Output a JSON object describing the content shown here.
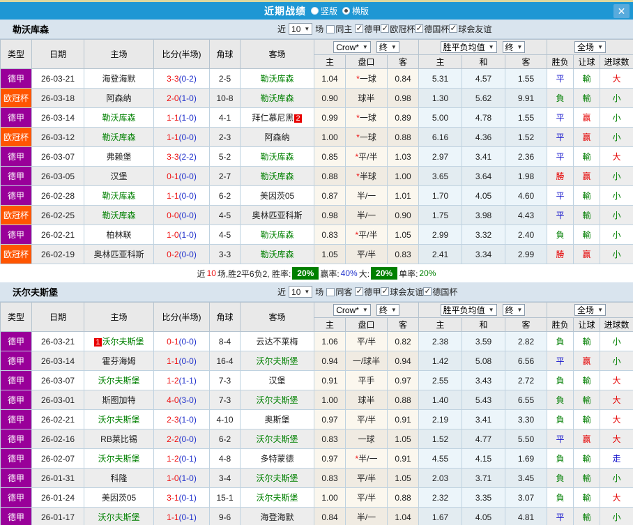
{
  "titlebar": {
    "title": "近期战绩",
    "radio_options": [
      {
        "label": "竖版",
        "selected": false
      },
      {
        "label": "横版",
        "selected": true
      }
    ],
    "close_label": "✕"
  },
  "labels": {
    "near": "近",
    "games": "场"
  },
  "table_header": {
    "cols": [
      "类型",
      "日期",
      "主场",
      "比分(半场)",
      "角球",
      "客场"
    ],
    "odds_source_dd": "Crow*",
    "odds_final_dd": "终",
    "avg_dd": "胜平负均值",
    "avg_final_dd": "终",
    "scope_dd": "全场",
    "sub": [
      "主",
      "盘口",
      "客",
      "主",
      "和",
      "客",
      "胜负",
      "让球",
      "进球数"
    ]
  },
  "league_colors": {
    "德甲": "#990099",
    "欧冠杯": "#ff5500"
  },
  "result_colors": {
    "勝": "res-red",
    "赢": "res-red",
    "大": "res-red",
    "負": "res-green",
    "輸": "res-green",
    "小": "res-green",
    "平": "res-blue",
    "走": "res-blue"
  },
  "sections": [
    {
      "team": "勒沃库森",
      "controls": {
        "count": "10",
        "same_label": "同主",
        "same_checked": false,
        "leagues": [
          {
            "label": "德甲",
            "checked": true
          },
          {
            "label": "欧冠杯",
            "checked": true
          },
          {
            "label": "德国杯",
            "checked": true
          },
          {
            "label": "球会友谊",
            "checked": true
          }
        ]
      },
      "rows": [
        {
          "league": "德甲",
          "date": "26-03-21",
          "home": "海登海默",
          "home_focus": false,
          "score": "3-3",
          "half": "(0-2)",
          "corner": "2-5",
          "away": "勒沃库森",
          "away_focus": true,
          "handicap": [
            "1.04",
            "*一球",
            "0.84"
          ],
          "avg": [
            "5.31",
            "4.57",
            "1.55"
          ],
          "results": [
            "平",
            "輸",
            "大"
          ]
        },
        {
          "league": "欧冠杯",
          "date": "26-03-18",
          "home": "阿森纳",
          "home_focus": false,
          "score": "2-0",
          "half": "(1-0)",
          "corner": "10-8",
          "away": "勒沃库森",
          "away_focus": true,
          "handicap": [
            "0.90",
            "球半",
            "0.98"
          ],
          "avg": [
            "1.30",
            "5.62",
            "9.91"
          ],
          "results": [
            "負",
            "輸",
            "小"
          ]
        },
        {
          "league": "德甲",
          "date": "26-03-14",
          "home": "勒沃库森",
          "home_focus": true,
          "score": "1-1",
          "half": "(1-0)",
          "corner": "4-1",
          "away": "拜仁慕尼黑",
          "away_focus": false,
          "away_badge": {
            "text": "2",
            "pos": "after"
          },
          "handicap": [
            "0.99",
            "*一球",
            "0.89"
          ],
          "avg": [
            "5.00",
            "4.78",
            "1.55"
          ],
          "results": [
            "平",
            "赢",
            "小"
          ]
        },
        {
          "league": "欧冠杯",
          "date": "26-03-12",
          "home": "勒沃库森",
          "home_focus": true,
          "score": "1-1",
          "half": "(0-0)",
          "corner": "2-3",
          "away": "阿森纳",
          "away_focus": false,
          "handicap": [
            "1.00",
            "*一球",
            "0.88"
          ],
          "avg": [
            "6.16",
            "4.36",
            "1.52"
          ],
          "results": [
            "平",
            "赢",
            "小"
          ]
        },
        {
          "league": "德甲",
          "date": "26-03-07",
          "home": "弗赖堡",
          "home_focus": false,
          "score": "3-3",
          "half": "(2-2)",
          "corner": "5-2",
          "away": "勒沃库森",
          "away_focus": true,
          "handicap": [
            "0.85",
            "*平/半",
            "1.03"
          ],
          "avg": [
            "2.97",
            "3.41",
            "2.36"
          ],
          "results": [
            "平",
            "輸",
            "大"
          ]
        },
        {
          "league": "德甲",
          "date": "26-03-05",
          "home": "汉堡",
          "home_focus": false,
          "score": "0-1",
          "half": "(0-0)",
          "corner": "2-7",
          "away": "勒沃库森",
          "away_focus": true,
          "handicap": [
            "0.88",
            "*半球",
            "1.00"
          ],
          "avg": [
            "3.65",
            "3.64",
            "1.98"
          ],
          "results": [
            "勝",
            "赢",
            "小"
          ]
        },
        {
          "league": "德甲",
          "date": "26-02-28",
          "home": "勒沃库森",
          "home_focus": true,
          "score": "1-1",
          "half": "(0-0)",
          "corner": "6-2",
          "away": "美因茨05",
          "away_focus": false,
          "handicap": [
            "0.87",
            "半/一",
            "1.01"
          ],
          "avg": [
            "1.70",
            "4.05",
            "4.60"
          ],
          "results": [
            "平",
            "輸",
            "小"
          ]
        },
        {
          "league": "欧冠杯",
          "date": "26-02-25",
          "home": "勒沃库森",
          "home_focus": true,
          "score": "0-0",
          "half": "(0-0)",
          "corner": "4-5",
          "away": "奥林匹亚科斯",
          "away_focus": false,
          "handicap": [
            "0.98",
            "半/一",
            "0.90"
          ],
          "avg": [
            "1.75",
            "3.98",
            "4.43"
          ],
          "results": [
            "平",
            "輸",
            "小"
          ]
        },
        {
          "league": "德甲",
          "date": "26-02-21",
          "home": "柏林联",
          "home_focus": false,
          "score": "1-0",
          "half": "(1-0)",
          "corner": "4-5",
          "away": "勒沃库森",
          "away_focus": true,
          "handicap": [
            "0.83",
            "*平/半",
            "1.05"
          ],
          "avg": [
            "2.99",
            "3.32",
            "2.40"
          ],
          "results": [
            "負",
            "輸",
            "小"
          ]
        },
        {
          "league": "欧冠杯",
          "date": "26-02-19",
          "home": "奥林匹亚科斯",
          "home_focus": false,
          "score": "0-2",
          "half": "(0-0)",
          "corner": "3-3",
          "away": "勒沃库森",
          "away_focus": true,
          "handicap": [
            "1.05",
            "平/半",
            "0.83"
          ],
          "avg": [
            "2.41",
            "3.34",
            "2.99"
          ],
          "results": [
            "勝",
            "赢",
            "小"
          ]
        }
      ],
      "summary": [
        {
          "t": "近",
          "s": "k"
        },
        {
          "t": "10",
          "s": "r"
        },
        {
          "t": "场,胜2平6负2, 胜率:",
          "s": "k"
        },
        {
          "t": "20%",
          "s": "badge"
        },
        {
          "t": "赢率:",
          "s": "k"
        },
        {
          "t": "40%",
          "s": "b"
        },
        {
          "t": "大:",
          "s": "k"
        },
        {
          "t": "20%",
          "s": "badge"
        },
        {
          "t": "单率:",
          "s": "k"
        },
        {
          "t": "20%",
          "s": "g"
        }
      ]
    },
    {
      "team": "沃尔夫斯堡",
      "controls": {
        "count": "10",
        "same_label": "同客",
        "same_checked": false,
        "leagues": [
          {
            "label": "德甲",
            "checked": true
          },
          {
            "label": "球会友谊",
            "checked": true
          },
          {
            "label": "德国杯",
            "checked": true
          }
        ]
      },
      "rows": [
        {
          "league": "德甲",
          "date": "26-03-21",
          "home": "沃尔夫斯堡",
          "home_focus": true,
          "home_badge": {
            "text": "1",
            "pos": "before"
          },
          "score": "0-1",
          "half": "(0-0)",
          "corner": "8-4",
          "away": "云达不莱梅",
          "away_focus": false,
          "handicap": [
            "1.06",
            "平/半",
            "0.82"
          ],
          "avg": [
            "2.38",
            "3.59",
            "2.82"
          ],
          "results": [
            "負",
            "輸",
            "小"
          ]
        },
        {
          "league": "德甲",
          "date": "26-03-14",
          "home": "霍芬海姆",
          "home_focus": false,
          "score": "1-1",
          "half": "(0-0)",
          "corner": "16-4",
          "away": "沃尔夫斯堡",
          "away_focus": true,
          "handicap": [
            "0.94",
            "一/球半",
            "0.94"
          ],
          "avg": [
            "1.42",
            "5.08",
            "6.56"
          ],
          "results": [
            "平",
            "赢",
            "小"
          ]
        },
        {
          "league": "德甲",
          "date": "26-03-07",
          "home": "沃尔夫斯堡",
          "home_focus": true,
          "score": "1-2",
          "half": "(1-1)",
          "corner": "7-3",
          "away": "汉堡",
          "away_focus": false,
          "handicap": [
            "0.91",
            "平手",
            "0.97"
          ],
          "avg": [
            "2.55",
            "3.43",
            "2.72"
          ],
          "results": [
            "負",
            "輸",
            "大"
          ]
        },
        {
          "league": "德甲",
          "date": "26-03-01",
          "home": "斯图加特",
          "home_focus": false,
          "score": "4-0",
          "half": "(3-0)",
          "corner": "7-3",
          "away": "沃尔夫斯堡",
          "away_focus": true,
          "handicap": [
            "1.00",
            "球半",
            "0.88"
          ],
          "avg": [
            "1.40",
            "5.43",
            "6.55"
          ],
          "results": [
            "負",
            "輸",
            "大"
          ]
        },
        {
          "league": "德甲",
          "date": "26-02-21",
          "home": "沃尔夫斯堡",
          "home_focus": true,
          "score": "2-3",
          "half": "(1-0)",
          "corner": "4-10",
          "away": "奥斯堡",
          "away_focus": false,
          "handicap": [
            "0.97",
            "平/半",
            "0.91"
          ],
          "avg": [
            "2.19",
            "3.41",
            "3.30"
          ],
          "results": [
            "負",
            "輸",
            "大"
          ]
        },
        {
          "league": "德甲",
          "date": "26-02-16",
          "home": "RB莱比锡",
          "home_focus": false,
          "score": "2-2",
          "half": "(0-0)",
          "corner": "6-2",
          "away": "沃尔夫斯堡",
          "away_focus": true,
          "handicap": [
            "0.83",
            "一球",
            "1.05"
          ],
          "avg": [
            "1.52",
            "4.77",
            "5.50"
          ],
          "results": [
            "平",
            "赢",
            "大"
          ]
        },
        {
          "league": "德甲",
          "date": "26-02-07",
          "home": "沃尔夫斯堡",
          "home_focus": true,
          "score": "1-2",
          "half": "(0-1)",
          "corner": "4-8",
          "away": "多特蒙德",
          "away_focus": false,
          "handicap": [
            "0.97",
            "*半/一",
            "0.91"
          ],
          "avg": [
            "4.55",
            "4.15",
            "1.69"
          ],
          "results": [
            "負",
            "輸",
            "走"
          ]
        },
        {
          "league": "德甲",
          "date": "26-01-31",
          "home": "科隆",
          "home_focus": false,
          "score": "1-0",
          "half": "(1-0)",
          "corner": "3-4",
          "away": "沃尔夫斯堡",
          "away_focus": true,
          "handicap": [
            "0.83",
            "平/半",
            "1.05"
          ],
          "avg": [
            "2.03",
            "3.71",
            "3.45"
          ],
          "results": [
            "負",
            "輸",
            "小"
          ]
        },
        {
          "league": "德甲",
          "date": "26-01-24",
          "home": "美因茨05",
          "home_focus": false,
          "score": "3-1",
          "half": "(0-1)",
          "corner": "15-1",
          "away": "沃尔夫斯堡",
          "away_focus": true,
          "handicap": [
            "1.00",
            "平/半",
            "0.88"
          ],
          "avg": [
            "2.32",
            "3.35",
            "3.07"
          ],
          "results": [
            "負",
            "輸",
            "大"
          ]
        },
        {
          "league": "德甲",
          "date": "26-01-17",
          "home": "沃尔夫斯堡",
          "home_focus": true,
          "score": "1-1",
          "half": "(0-1)",
          "corner": "9-6",
          "away": "海登海默",
          "away_focus": false,
          "handicap": [
            "0.84",
            "半/一",
            "1.04"
          ],
          "avg": [
            "1.67",
            "4.05",
            "4.81"
          ],
          "results": [
            "平",
            "輸",
            "小"
          ]
        }
      ]
    }
  ]
}
